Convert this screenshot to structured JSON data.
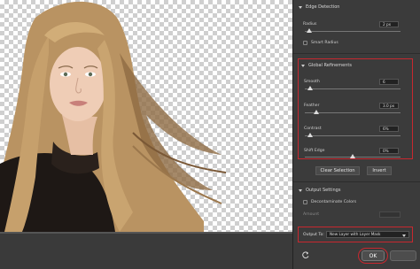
{
  "panel": {
    "edge_detection": {
      "header": "Edge Detection",
      "radius_label": "Radius",
      "radius_value": "2 px",
      "radius_level": 0.05,
      "smart_radius_label": "Smart Radius"
    },
    "global_refinements": {
      "header": "Global Refinements",
      "smooth_label": "Smooth",
      "smooth_value": "6",
      "smooth_level": 0.06,
      "feather_label": "Feather",
      "feather_value": "3.0 px",
      "feather_level": 0.12,
      "contrast_label": "Contrast",
      "contrast_value": "6%",
      "contrast_level": 0.06,
      "shift_edge_label": "Shift Edge",
      "shift_edge_value": "0%",
      "shift_edge_level": 0.5
    },
    "buttons": {
      "clear_selection": "Clear Selection",
      "invert": "Invert"
    },
    "output_settings": {
      "header": "Output Settings",
      "decontaminate_label": "Decontaminate Colors",
      "amount_label": "Amount",
      "output_to_label": "Output To:",
      "output_to_value": "New Layer with Layer Mask"
    },
    "footer": {
      "ok_label": "OK"
    }
  },
  "colors": {
    "highlight": "#c8282f",
    "panel_bg": "#3b3b3b"
  }
}
